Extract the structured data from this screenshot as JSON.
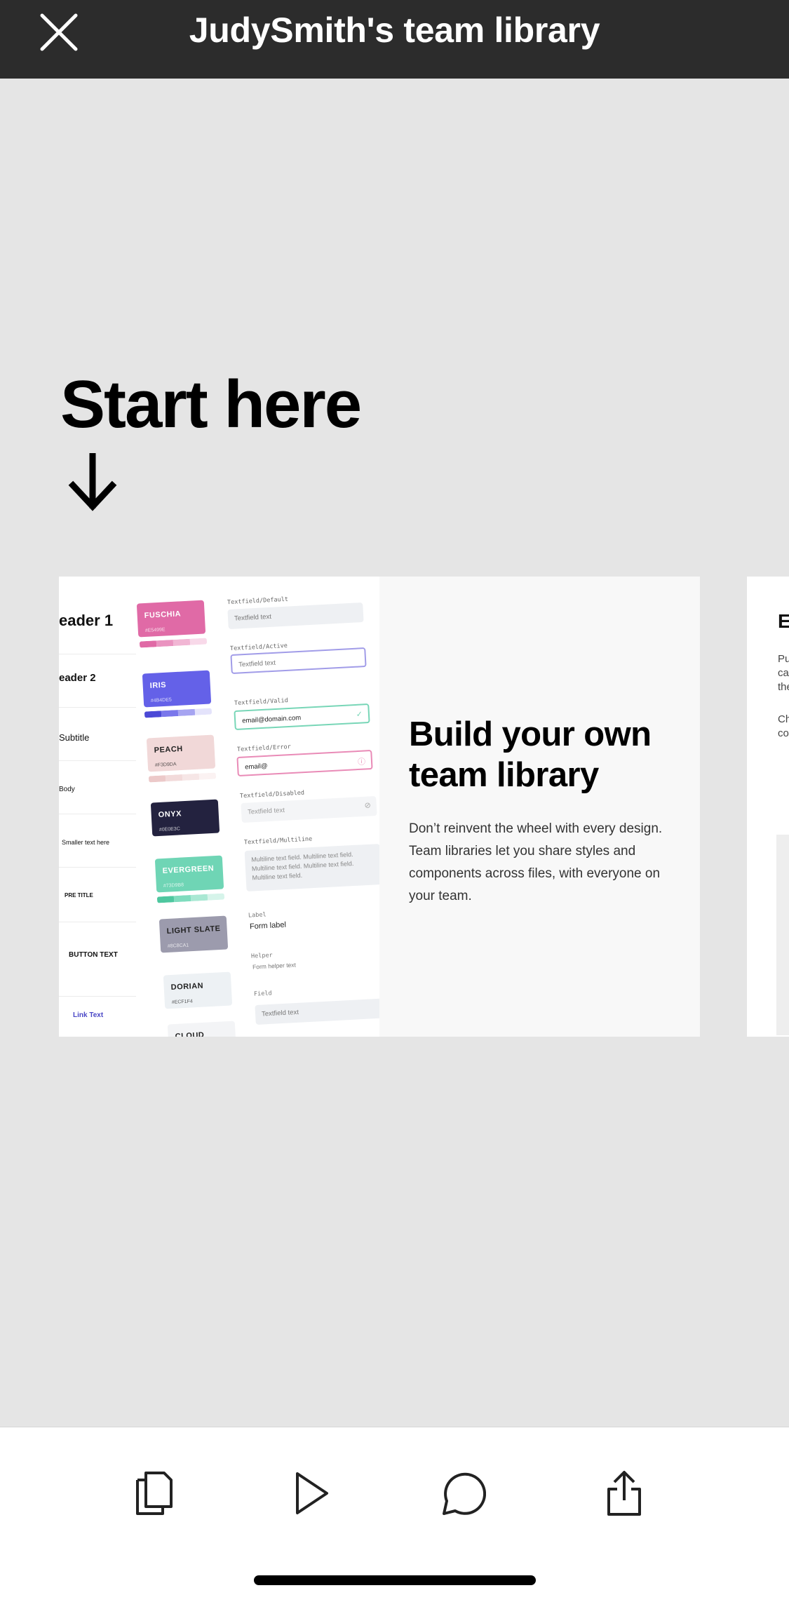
{
  "header": {
    "title": "JudySmith's team library",
    "close_icon": "close-icon"
  },
  "canvas": {
    "start_title": "Start here",
    "arrow_icon": "arrow-down-icon",
    "card": {
      "heading": "Build your own team library",
      "body": "Don’t reinvent the wheel with every design. Team libraries let you share styles and components across files, with everyone on your team.",
      "typography_labels": [
        "eader 1",
        "eader 2",
        "Subtitle",
        "Body",
        "Smaller text here",
        "PRE TITLE",
        "BUTTON TEXT",
        "Link Text"
      ],
      "swatches": [
        {
          "name": "FUSCHIA",
          "hex": "#E5499E",
          "color": "#e06aa6"
        },
        {
          "name": "IRIS",
          "hex": "#4B4DE5",
          "color": "#6461e8"
        },
        {
          "name": "PEACH",
          "hex": "#F3D9DA",
          "color": "#f1d8d8"
        },
        {
          "name": "ONYX",
          "hex": "#0E0E3C",
          "color": "#23223f"
        },
        {
          "name": "EVERGREEN",
          "hex": "#73D9B8",
          "color": "#6fd5b5"
        },
        {
          "name": "LIGHT SLATE",
          "hex": "#8C8CA1",
          "color": "#9c9bad"
        },
        {
          "name": "DORIAN",
          "hex": "#ECF1F4",
          "color": "#edf1f4"
        },
        {
          "name": "CLOUD",
          "hex": "",
          "color": "#f3f4f6"
        }
      ],
      "textfields": [
        {
          "label": "Textfield/Default",
          "value": "Textfield text"
        },
        {
          "label": "Textfield/Active",
          "value": "Textfield text"
        },
        {
          "label": "Textfield/Valid",
          "value": "email@domain.com"
        },
        {
          "label": "Textfield/Error",
          "value": "email@"
        },
        {
          "label": "Textfield/Disabled",
          "value": "Textfield text"
        },
        {
          "label": "Textfield/Multiline",
          "value": "Multiline text field. Multiline text field. Multiline text field. Multiline text field. Multiline text field."
        }
      ],
      "form": {
        "label_caption": "Label",
        "label_value": "Form label",
        "helper_caption": "Helper",
        "helper_value": "Form helper text",
        "field_caption": "Field",
        "field_value": "Textfield text"
      }
    },
    "next_card": {
      "heading": "E",
      "lines": [
        "Pu",
        "ca",
        "the",
        "Ch",
        "co"
      ]
    }
  },
  "toolbar": {
    "pages_icon": "pages-icon",
    "play_icon": "play-icon",
    "comment_icon": "comment-icon",
    "share_icon": "share-icon"
  }
}
